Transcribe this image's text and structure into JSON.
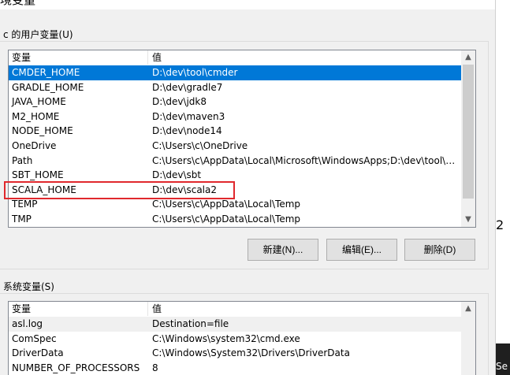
{
  "window": {
    "title": "境变量"
  },
  "user_vars": {
    "label": "c 的用户变量(U)",
    "headers": {
      "name": "变量",
      "value": "值"
    },
    "rows": [
      {
        "name": "CMDER_HOME",
        "value": "D:\\dev\\tool\\cmder"
      },
      {
        "name": "GRADLE_HOME",
        "value": "D:\\dev\\gradle7"
      },
      {
        "name": "JAVA_HOME",
        "value": "D:\\dev\\jdk8"
      },
      {
        "name": "M2_HOME",
        "value": "D:\\dev\\maven3"
      },
      {
        "name": "NODE_HOME",
        "value": "D:\\dev\\node14"
      },
      {
        "name": "OneDrive",
        "value": "C:\\Users\\c\\OneDrive"
      },
      {
        "name": "Path",
        "value": "C:\\Users\\c\\AppData\\Local\\Microsoft\\WindowsApps;D:\\dev\\tool\\c..."
      },
      {
        "name": "SBT_HOME",
        "value": "D:\\dev\\sbt"
      },
      {
        "name": "SCALA_HOME",
        "value": "D:\\dev\\scala2"
      },
      {
        "name": "TEMP",
        "value": "C:\\Users\\c\\AppData\\Local\\Temp"
      },
      {
        "name": "TMP",
        "value": "C:\\Users\\c\\AppData\\Local\\Temp"
      }
    ],
    "selected_index": 0,
    "highlighted": "SCALA_HOME",
    "buttons": {
      "new": "新建(N)...",
      "edit": "编辑(E)...",
      "delete": "删除(D)"
    }
  },
  "system_vars": {
    "label": "系统变量(S)",
    "headers": {
      "name": "变量",
      "value": "值"
    },
    "rows": [
      {
        "name": "asl.log",
        "value": "Destination=file"
      },
      {
        "name": "ComSpec",
        "value": "C:\\Windows\\system32\\cmd.exe"
      },
      {
        "name": "DriverData",
        "value": "C:\\Windows\\System32\\Drivers\\DriverData"
      },
      {
        "name": "NUMBER_OF_PROCESSORS",
        "value": "8"
      }
    ]
  },
  "background": {
    "side_text": "2",
    "taskbar_text": "Se"
  },
  "icons": {
    "scroll_up": "▲",
    "scroll_down": "▼"
  },
  "colors": {
    "selection": "#0078d7",
    "highlight_box": "#e0282d"
  }
}
